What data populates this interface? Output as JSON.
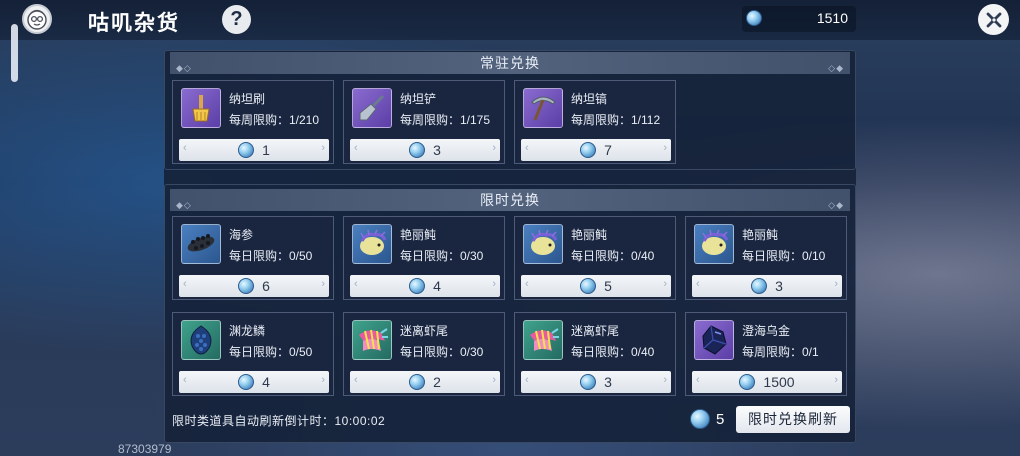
{
  "header": {
    "title": "咕叽杂货",
    "help_label": "?",
    "currency_value": "1510"
  },
  "sections": {
    "permanent": {
      "title": "常驻兑换"
    },
    "limited": {
      "title": "限时兑换"
    }
  },
  "permanent_items": [
    {
      "name": "纳坦刷",
      "limit": "每周限购：1/210",
      "price": "1",
      "icon": "brush-icon"
    },
    {
      "name": "纳坦铲",
      "limit": "每周限购：1/175",
      "price": "3",
      "icon": "shovel-icon"
    },
    {
      "name": "纳坦镐",
      "limit": "每周限购：1/112",
      "price": "7",
      "icon": "pickaxe-icon"
    }
  ],
  "limited_items": [
    {
      "name": "海参",
      "limit": "每日限购：0/50",
      "price": "6",
      "icon": "sea-cucumber-icon"
    },
    {
      "name": "艳丽鲀",
      "limit": "每日限购：0/30",
      "price": "4",
      "icon": "puffer-fish-icon"
    },
    {
      "name": "艳丽鲀",
      "limit": "每日限购：0/40",
      "price": "5",
      "icon": "puffer-fish-icon"
    },
    {
      "name": "艳丽鲀",
      "limit": "每日限购：0/10",
      "price": "3",
      "icon": "puffer-fish-icon"
    },
    {
      "name": "渊龙鳞",
      "limit": "每日限购：0/50",
      "price": "4",
      "icon": "dragon-scale-icon"
    },
    {
      "name": "迷离虾尾",
      "limit": "每日限购：0/30",
      "price": "2",
      "icon": "shrimp-tail-icon"
    },
    {
      "name": "迷离虾尾",
      "limit": "每日限购：0/40",
      "price": "3",
      "icon": "shrimp-tail-icon"
    },
    {
      "name": "澄海乌金",
      "limit": "每周限购：0/1",
      "price": "1500",
      "icon": "dark-ore-icon"
    }
  ],
  "footer": {
    "countdown_text": "限时类道具自动刷新倒计时：10:00:02",
    "refresh_count": "5",
    "refresh_button": "限时兑换刷新"
  },
  "uid": "87303979",
  "colors": {
    "panel": "#16223a",
    "header_band": "#56667f",
    "price_bar": "#eef1f5",
    "accent_coin": "#9ad2f2"
  }
}
